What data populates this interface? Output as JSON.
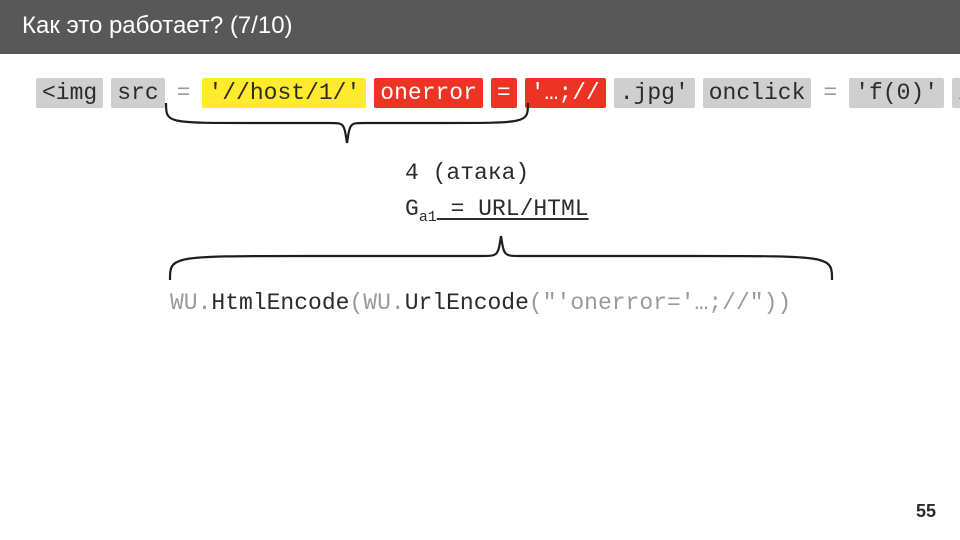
{
  "title": "Как это работает? (7/10)",
  "code": {
    "t1": "<img",
    "t2": "src",
    "eq": "=",
    "t3": "'//host/1/'",
    "t4": "onerror",
    "t5": "'…;//",
    "t6": ".jpg'",
    "t7": "onclick",
    "t8": "'f(0)'",
    "t9": "/>"
  },
  "annot": {
    "line1": "4 (атака)",
    "g_label": "G",
    "g_sub": "a1",
    "g_rest": " = URL/HTML"
  },
  "solution": {
    "p1": "WU",
    "p2": ".",
    "p3": "HtmlEncode",
    "p4": "(",
    "p5": "WU",
    "p6": ".",
    "p7": "UrlEncode",
    "p8": "(",
    "p9": "\"'onerror='…;//\"",
    "p10": "))"
  },
  "page_number": "55"
}
